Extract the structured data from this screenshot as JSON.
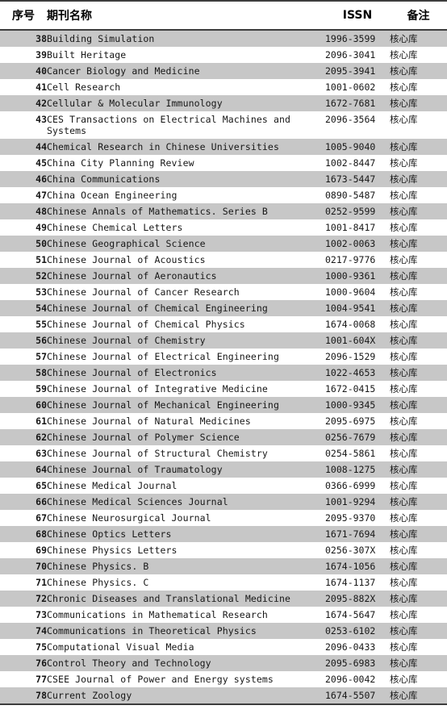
{
  "table": {
    "columns": [
      {
        "key": "no",
        "label": "序号"
      },
      {
        "key": "name",
        "label": "期刊名称"
      },
      {
        "key": "issn",
        "label": "ISSN"
      },
      {
        "key": "remark",
        "label": "备注"
      }
    ],
    "colors": {
      "shaded_row": "#c7c7c7",
      "plain_row": "#ffffff",
      "rule": "#3d3d3d",
      "text": "#171717"
    },
    "rows": [
      {
        "no": "38",
        "name": "Building Simulation",
        "issn": "1996-3599",
        "remark": "核心库",
        "shaded": true
      },
      {
        "no": "39",
        "name": "Built Heritage",
        "issn": "2096-3041",
        "remark": "核心库",
        "shaded": false
      },
      {
        "no": "40",
        "name": "Cancer Biology and Medicine",
        "issn": "2095-3941",
        "remark": "核心库",
        "shaded": true
      },
      {
        "no": "41",
        "name": "Cell Research",
        "issn": "1001-0602",
        "remark": "核心库",
        "shaded": false
      },
      {
        "no": "42",
        "name": "Cellular & Molecular Immunology",
        "issn": "1672-7681",
        "remark": "核心库",
        "shaded": true
      },
      {
        "no": "43",
        "name": "CES Transactions on Electrical Machines and Systems",
        "name_lines": [
          "CES Transactions on Electrical Machines and",
          "Systems"
        ],
        "issn": "2096-3564",
        "remark": "核心库",
        "shaded": false
      },
      {
        "no": "44",
        "name": "Chemical Research in Chinese Universities",
        "issn": "1005-9040",
        "remark": "核心库",
        "shaded": true
      },
      {
        "no": "45",
        "name": "China City Planning Review",
        "issn": "1002-8447",
        "remark": "核心库",
        "shaded": false
      },
      {
        "no": "46",
        "name": "China Communications",
        "issn": "1673-5447",
        "remark": "核心库",
        "shaded": true
      },
      {
        "no": "47",
        "name": "China Ocean Engineering",
        "issn": "0890-5487",
        "remark": "核心库",
        "shaded": false
      },
      {
        "no": "48",
        "name": "Chinese Annals of Mathematics. Series B",
        "issn": "0252-9599",
        "remark": "核心库",
        "shaded": true
      },
      {
        "no": "49",
        "name": "Chinese Chemical Letters",
        "issn": "1001-8417",
        "remark": "核心库",
        "shaded": false
      },
      {
        "no": "50",
        "name": "Chinese Geographical Science",
        "issn": "1002-0063",
        "remark": "核心库",
        "shaded": true
      },
      {
        "no": "51",
        "name": "Chinese Journal of Acoustics",
        "issn": "0217-9776",
        "remark": "核心库",
        "shaded": false
      },
      {
        "no": "52",
        "name": "Chinese Journal of Aeronautics",
        "issn": "1000-9361",
        "remark": "核心库",
        "shaded": true
      },
      {
        "no": "53",
        "name": "Chinese Journal of Cancer Research",
        "issn": "1000-9604",
        "remark": "核心库",
        "shaded": false
      },
      {
        "no": "54",
        "name": "Chinese Journal of Chemical Engineering",
        "issn": "1004-9541",
        "remark": "核心库",
        "shaded": true
      },
      {
        "no": "55",
        "name": "Chinese Journal of Chemical Physics",
        "issn": "1674-0068",
        "remark": "核心库",
        "shaded": false
      },
      {
        "no": "56",
        "name": "Chinese Journal of Chemistry",
        "issn": "1001-604X",
        "remark": "核心库",
        "shaded": true
      },
      {
        "no": "57",
        "name": "Chinese Journal of Electrical Engineering",
        "issn": "2096-1529",
        "remark": "核心库",
        "shaded": false
      },
      {
        "no": "58",
        "name": "Chinese Journal of Electronics",
        "issn": "1022-4653",
        "remark": "核心库",
        "shaded": true
      },
      {
        "no": "59",
        "name": "Chinese Journal of Integrative Medicine",
        "issn": "1672-0415",
        "remark": "核心库",
        "shaded": false
      },
      {
        "no": "60",
        "name": "Chinese Journal of Mechanical Engineering",
        "issn": "1000-9345",
        "remark": "核心库",
        "shaded": true
      },
      {
        "no": "61",
        "name": "Chinese Journal of Natural Medicines",
        "issn": "2095-6975",
        "remark": "核心库",
        "shaded": false
      },
      {
        "no": "62",
        "name": "Chinese Journal of Polymer Science",
        "issn": "0256-7679",
        "remark": "核心库",
        "shaded": true
      },
      {
        "no": "63",
        "name": "Chinese Journal of Structural Chemistry",
        "issn": "0254-5861",
        "remark": "核心库",
        "shaded": false
      },
      {
        "no": "64",
        "name": "Chinese Journal of Traumatology",
        "issn": "1008-1275",
        "remark": "核心库",
        "shaded": true
      },
      {
        "no": "65",
        "name": "Chinese Medical Journal",
        "issn": "0366-6999",
        "remark": "核心库",
        "shaded": false
      },
      {
        "no": "66",
        "name": "Chinese Medical Sciences Journal",
        "issn": "1001-9294",
        "remark": "核心库",
        "shaded": true
      },
      {
        "no": "67",
        "name": "Chinese Neurosurgical Journal",
        "issn": "2095-9370",
        "remark": "核心库",
        "shaded": false
      },
      {
        "no": "68",
        "name": "Chinese Optics Letters",
        "issn": "1671-7694",
        "remark": "核心库",
        "shaded": true
      },
      {
        "no": "69",
        "name": "Chinese Physics Letters",
        "issn": "0256-307X",
        "remark": "核心库",
        "shaded": false
      },
      {
        "no": "70",
        "name": "Chinese Physics. B",
        "issn": "1674-1056",
        "remark": "核心库",
        "shaded": true
      },
      {
        "no": "71",
        "name": "Chinese Physics. C",
        "issn": "1674-1137",
        "remark": "核心库",
        "shaded": false
      },
      {
        "no": "72",
        "name": "Chronic Diseases and Translational Medicine",
        "issn": "2095-882X",
        "remark": "核心库",
        "shaded": true
      },
      {
        "no": "73",
        "name": "Communications in Mathematical Research",
        "issn": "1674-5647",
        "remark": "核心库",
        "shaded": false
      },
      {
        "no": "74",
        "name": "Communications in Theoretical Physics",
        "issn": "0253-6102",
        "remark": "核心库",
        "shaded": true
      },
      {
        "no": "75",
        "name": "Computational Visual Media",
        "issn": "2096-0433",
        "remark": "核心库",
        "shaded": false
      },
      {
        "no": "76",
        "name": "Control Theory and Technology",
        "issn": "2095-6983",
        "remark": "核心库",
        "shaded": true
      },
      {
        "no": "77",
        "name": "CSEE Journal of Power and Energy systems",
        "issn": "2096-0042",
        "remark": "核心库",
        "shaded": false
      },
      {
        "no": "78",
        "name": "Current Zoology",
        "issn": "1674-5507",
        "remark": "核心库",
        "shaded": true
      }
    ]
  }
}
